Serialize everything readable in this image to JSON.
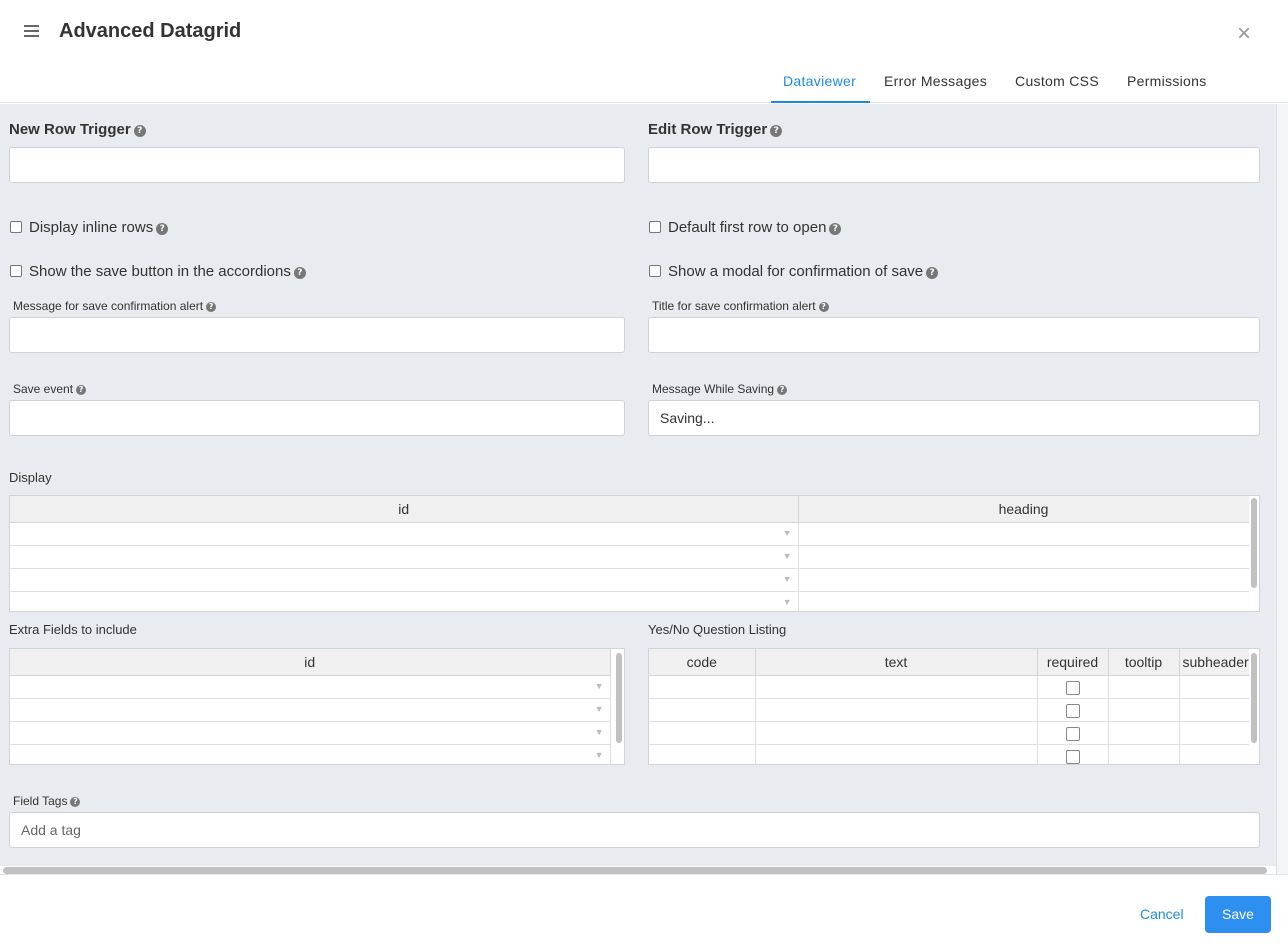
{
  "header": {
    "title": "Advanced Datagrid",
    "close": "×",
    "tabs": [
      {
        "label": "Dataviewer",
        "active": true
      },
      {
        "label": "Error Messages",
        "active": false
      },
      {
        "label": "Custom CSS",
        "active": false
      },
      {
        "label": "Permissions",
        "active": false
      }
    ]
  },
  "form": {
    "new_row_trigger": {
      "label": "New Row Trigger",
      "value": ""
    },
    "edit_row_trigger": {
      "label": "Edit Row Trigger",
      "value": ""
    },
    "display_inline_rows": {
      "label": "Display inline rows",
      "checked": false
    },
    "default_first_row": {
      "label": "Default first row to open",
      "checked": false
    },
    "show_save_button": {
      "label": "Show the save button in the accordions",
      "checked": false
    },
    "show_modal": {
      "label": "Show a modal for confirmation of save",
      "checked": false
    },
    "save_confirm_message": {
      "label": "Message for save confirmation alert",
      "value": ""
    },
    "save_confirm_title": {
      "label": "Title for save confirmation alert",
      "value": ""
    },
    "save_event": {
      "label": "Save event",
      "value": ""
    },
    "message_while_saving": {
      "label": "Message While Saving",
      "value": "Saving..."
    },
    "display": {
      "label": "Display",
      "columns": [
        "id",
        "heading"
      ],
      "row_count": 4
    },
    "extra_fields": {
      "label": "Extra Fields to include",
      "columns": [
        "id"
      ],
      "row_count": 4
    },
    "yes_no": {
      "label": "Yes/No Question Listing",
      "columns": [
        "code",
        "text",
        "required",
        "tooltip",
        "subheader"
      ],
      "row_count": 4
    },
    "field_tags": {
      "label": "Field Tags",
      "placeholder": "Add a tag"
    }
  },
  "footer": {
    "cancel_label": "Cancel",
    "save_label": "Save"
  },
  "colors": {
    "accent": "#1d8ce0",
    "save_button": "#2d8ff0",
    "panel_bg": "#e8ebef"
  },
  "icons": {
    "help": "question-circle-icon",
    "menu": "hamburger-menu-icon",
    "close": "close-icon",
    "dropdown": "caret-down-icon"
  }
}
